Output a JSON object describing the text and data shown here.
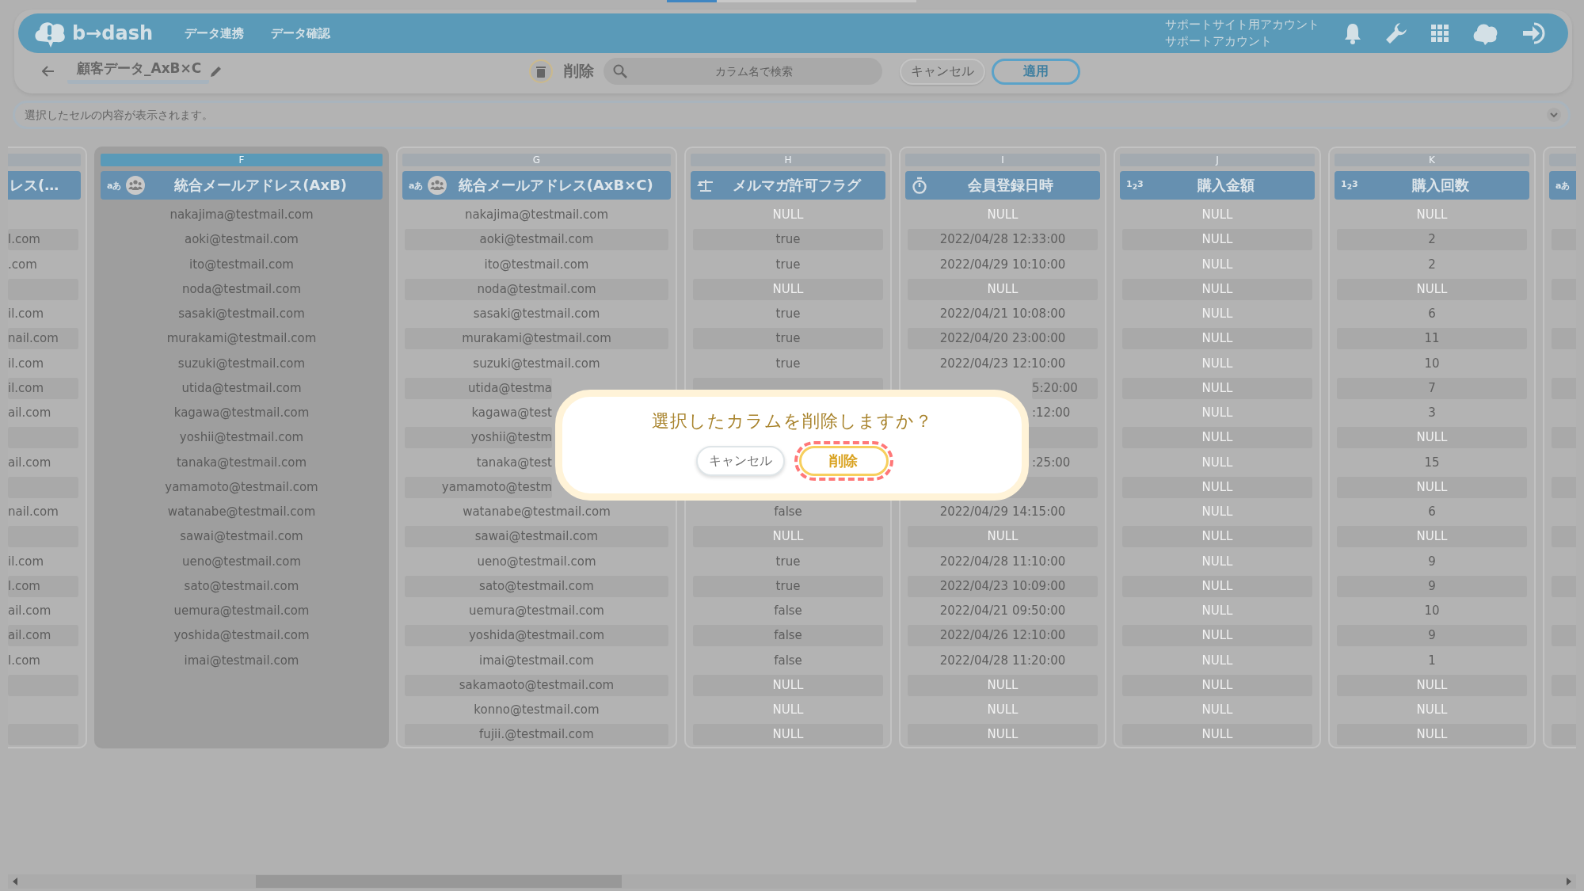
{
  "progress": {
    "level": 0.2
  },
  "header": {
    "logo": "b→dash",
    "nav": [
      "データ連携",
      "データ確認"
    ],
    "account": {
      "site": "サポートサイト用アカウント",
      "user": "サポートアカウント"
    }
  },
  "toolbar": {
    "title": "顧客データ_AxB×C",
    "delete_label": "削除",
    "search": {
      "placeholder": "カラム名で検索"
    },
    "buttons": [
      {
        "label": "キャンセル",
        "kind": "secondary"
      },
      {
        "label": "適用",
        "kind": "primary"
      }
    ]
  },
  "cell_viewer": {
    "placeholder": "選択したセルの内容が表示されます。"
  },
  "columns": [
    {
      "cut_left": true,
      "name": "レス(…",
      "selected": false,
      "cells": [
        null,
        "l.com",
        ".com",
        null,
        "il.com",
        "nail.com",
        "il.com",
        "il.com",
        "ail.com",
        null,
        "ail.com",
        null,
        "nail.com",
        null,
        "il.com",
        "l.com",
        "ail.com",
        "ail.com",
        "l.com",
        null,
        null,
        null
      ]
    },
    {
      "letter": "F",
      "kind": "text",
      "type_label": "aあ",
      "merged": true,
      "name": "統合メールアドレス(AxB)",
      "selected": true,
      "cells": [
        "nakajima@testmail.com",
        "aoki@testmail.com",
        "ito@testmail.com",
        "noda@testmail.com",
        "sasaki@testmail.com",
        "murakami@testmail.com",
        "suzuki@testmail.com",
        "utida@testmail.com",
        "kagawa@testmail.com",
        "yoshii@testmail.com",
        "tanaka@testmail.com",
        "yamamoto@testmail.com",
        "watanabe@testmail.com",
        "sawai@testmail.com",
        "ueno@testmail.com",
        "sato@testmail.com",
        "uemura@testmail.com",
        "yoshida@testmail.com",
        "imai@testmail.com",
        null,
        null,
        null
      ]
    },
    {
      "letter": "G",
      "kind": "text",
      "type_label": "aあ",
      "merged": true,
      "name": "統合メールアドレス(AxB×C)",
      "selected": false,
      "cells": [
        "nakajima@testmail.com",
        "aoki@testmail.com",
        "ito@testmail.com",
        "noda@testmail.com",
        "sasaki@testmail.com",
        "murakami@testmail.com",
        "suzuki@testmail.com",
        {
          "text": "utida@testma",
          "kind": "head"
        },
        {
          "text": "kagawa@test",
          "kind": "head"
        },
        {
          "text": "yoshii@testm",
          "kind": "head"
        },
        {
          "text": "tanaka@test",
          "kind": "head"
        },
        {
          "text": "yamamoto@testm",
          "kind": "head"
        },
        "watanabe@testmail.com",
        "sawai@testmail.com",
        "ueno@testmail.com",
        "sato@testmail.com",
        "uemura@testmail.com",
        "yoshida@testmail.com",
        "imai@testmail.com",
        "sakamaoto@testmail.com",
        "konno@testmail.com",
        "fujii.@testmail.com"
      ]
    },
    {
      "letter": "H",
      "kind": "flag",
      "name": "メルマガ許可フラグ",
      "selected": false,
      "cells": [
        {
          "text": "NULL",
          "kind": "null"
        },
        "true",
        "true",
        {
          "text": "NULL",
          "kind": "null"
        },
        "true",
        "true",
        "true",
        null,
        null,
        null,
        null,
        null,
        "false",
        {
          "text": "NULL",
          "kind": "null"
        },
        "true",
        "true",
        "false",
        "false",
        "false",
        {
          "text": "NULL",
          "kind": "null"
        },
        {
          "text": "NULL",
          "kind": "null"
        },
        {
          "text": "NULL",
          "kind": "null"
        }
      ]
    },
    {
      "letter": "I",
      "kind": "datetime",
      "name": "会員登録日時",
      "selected": false,
      "cells": [
        {
          "text": "NULL",
          "kind": "null"
        },
        "2022/04/28 12:33:00",
        "2022/04/29 10:10:00",
        {
          "text": "NULL",
          "kind": "null"
        },
        "2022/04/21 10:08:00",
        "2022/04/20 23:00:00",
        "2022/04/23 12:10:00",
        {
          "text": "5:20:00",
          "kind": "tail"
        },
        {
          "text": ":12:00",
          "kind": "tail"
        },
        null,
        {
          "text": ":25:00",
          "kind": "tail"
        },
        null,
        "2022/04/29 14:15:00",
        {
          "text": "NULL",
          "kind": "null"
        },
        "2022/04/28 11:10:00",
        "2022/04/23 10:09:00",
        "2022/04/21 09:50:00",
        "2022/04/26 12:10:00",
        "2022/04/28 11:20:00",
        {
          "text": "NULL",
          "kind": "null"
        },
        {
          "text": "NULL",
          "kind": "null"
        },
        {
          "text": "NULL",
          "kind": "null"
        }
      ]
    },
    {
      "letter": "J",
      "kind": "number",
      "type_label": "1$_{2}$3",
      "name": "購入金額",
      "selected": false,
      "cells": [
        {
          "text": "NULL",
          "kind": "null"
        },
        {
          "text": "NULL",
          "kind": "null"
        },
        {
          "text": "NULL",
          "kind": "null"
        },
        {
          "text": "NULL",
          "kind": "null"
        },
        {
          "text": "NULL",
          "kind": "null"
        },
        {
          "text": "NULL",
          "kind": "null"
        },
        {
          "text": "NULL",
          "kind": "null"
        },
        {
          "text": "NULL",
          "kind": "null"
        },
        {
          "text": "NULL",
          "kind": "null"
        },
        {
          "text": "NULL",
          "kind": "null"
        },
        {
          "text": "NULL",
          "kind": "null"
        },
        {
          "text": "NULL",
          "kind": "null"
        },
        {
          "text": "NULL",
          "kind": "null"
        },
        {
          "text": "NULL",
          "kind": "null"
        },
        {
          "text": "NULL",
          "kind": "null"
        },
        {
          "text": "NULL",
          "kind": "null"
        },
        {
          "text": "NULL",
          "kind": "null"
        },
        {
          "text": "NULL",
          "kind": "null"
        },
        {
          "text": "NULL",
          "kind": "null"
        },
        {
          "text": "NULL",
          "kind": "null"
        },
        {
          "text": "NULL",
          "kind": "null"
        },
        {
          "text": "NULL",
          "kind": "null"
        }
      ]
    },
    {
      "letter": "K",
      "kind": "number",
      "type_label": "1$_{2}$3",
      "name": "購入回数",
      "selected": false,
      "cells": [
        {
          "text": "NULL",
          "kind": "null"
        },
        "2",
        "2",
        {
          "text": "NULL",
          "kind": "null"
        },
        "6",
        "11",
        "10",
        "7",
        "3",
        {
          "text": "NULL",
          "kind": "null"
        },
        "15",
        {
          "text": "NULL",
          "kind": "null"
        },
        "6",
        {
          "text": "NULL",
          "kind": "null"
        },
        "9",
        "9",
        "10",
        "9",
        "1",
        {
          "text": "NULL",
          "kind": "null"
        },
        {
          "text": "NULL",
          "kind": "null"
        },
        {
          "text": "NULL",
          "kind": "null"
        }
      ]
    },
    {
      "cut_right": true,
      "kind": "text",
      "type_label": "aあ",
      "selected": false,
      "cells": [
        null,
        null,
        null,
        null,
        null,
        null,
        null,
        null,
        null,
        null,
        null,
        null,
        null,
        null,
        null,
        null,
        null,
        null,
        null,
        null,
        null,
        null
      ]
    }
  ],
  "dialog": {
    "message": "選択したカラムを削除しますか？",
    "buttons": [
      {
        "label": "キャンセル",
        "kind": "secondary",
        "highlighted": false
      },
      {
        "label": "削除",
        "kind": "danger",
        "highlighted": true
      }
    ]
  }
}
